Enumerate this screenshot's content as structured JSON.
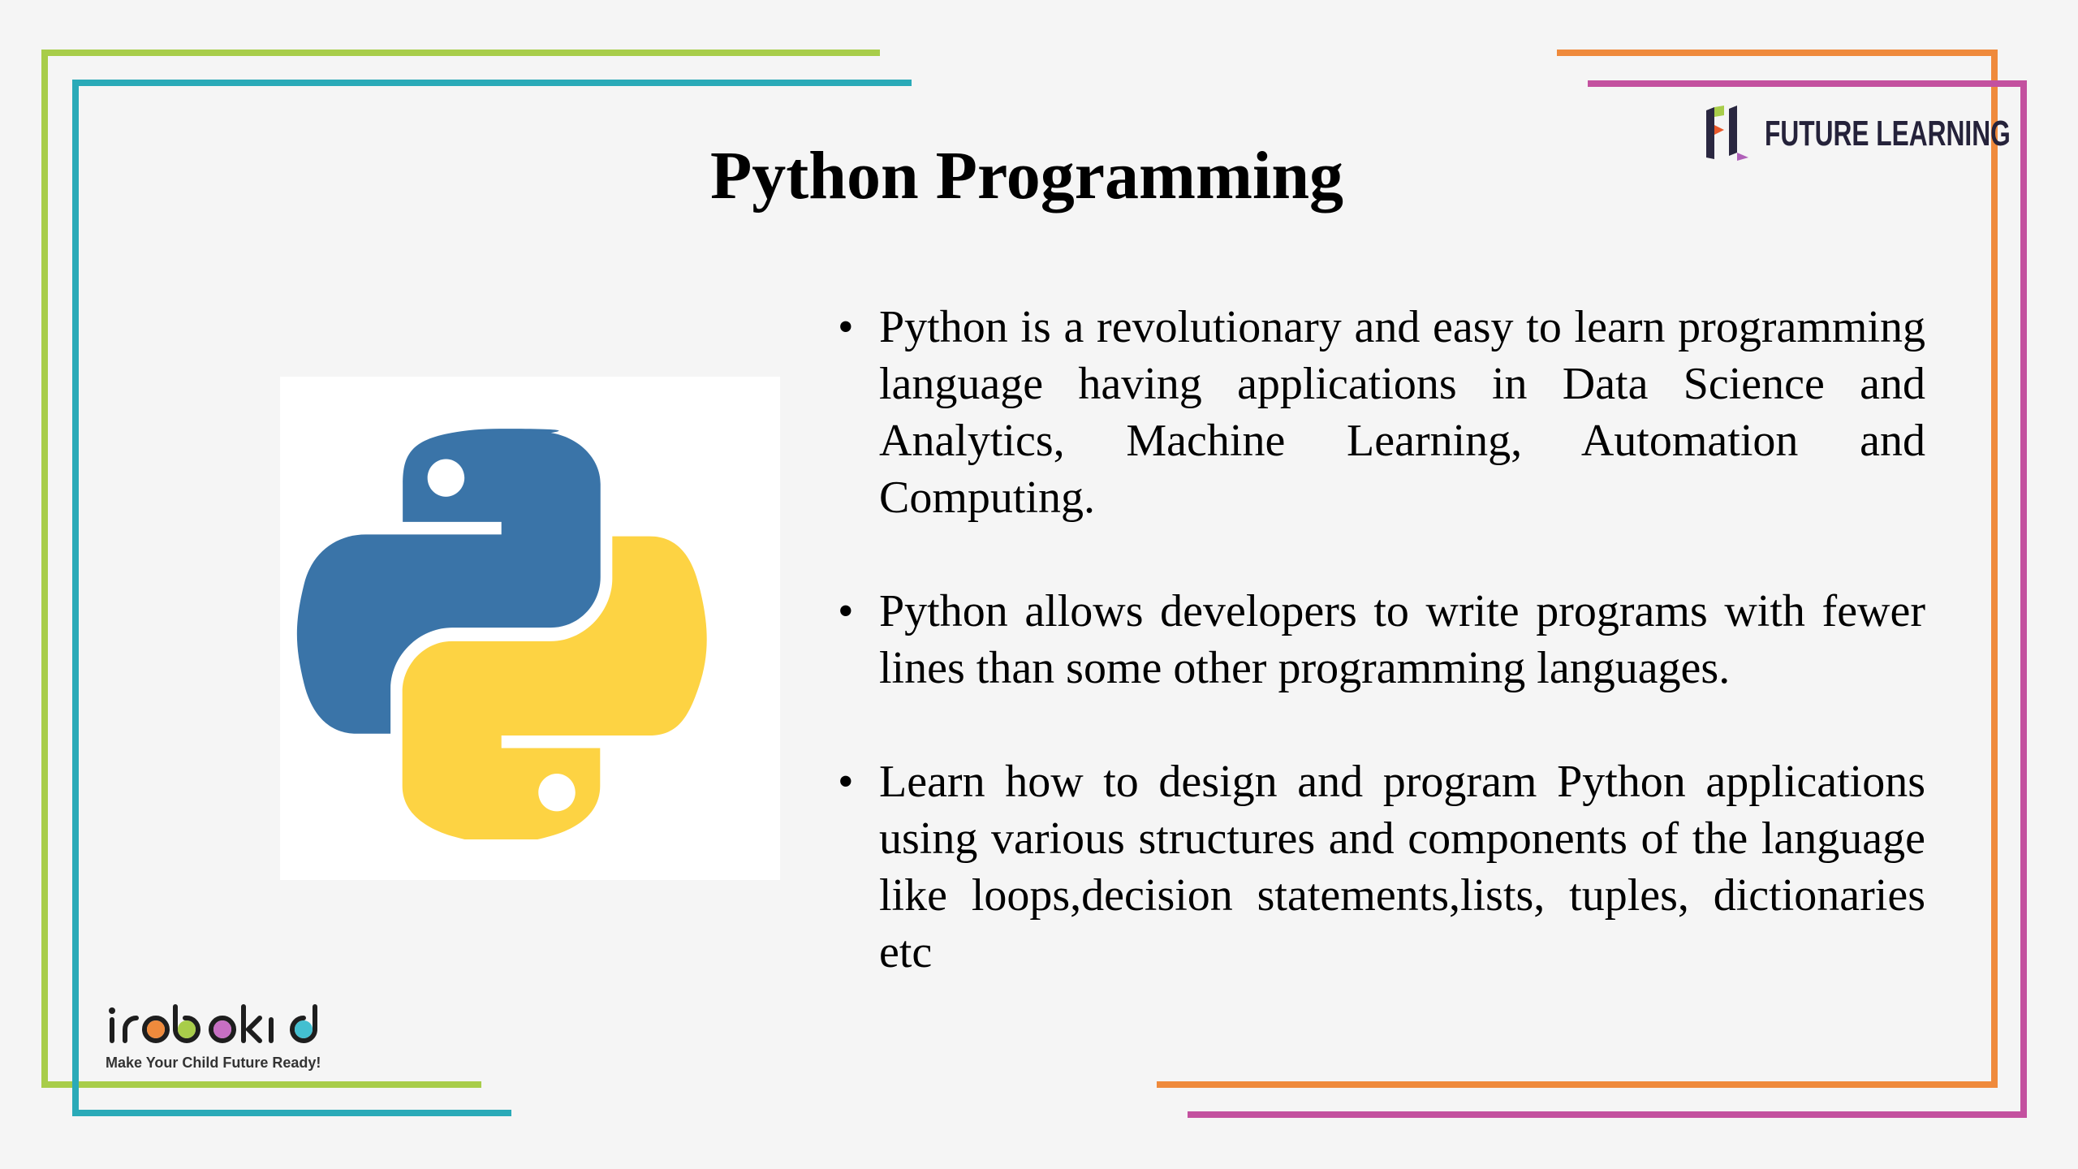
{
  "slide": {
    "title": "Python Programming",
    "bullets": [
      "Python is a revolutionary and easy to learn programming language having applications in Data Science and Analytics, Machine Learning, Automation and Computing.",
      "Python allows developers to write programs with fewer lines than some other programming languages.",
      "Learn how to design and program Python applications using various structures and components of the language like loops,decision statements,lists, tuples, dictionaries etc"
    ],
    "bullet_symbol": "•"
  },
  "logos": {
    "future_learning": "FUTURE LEARNING",
    "irobokid": "irobokid",
    "irobokid_tagline": "Make Your Child Future Ready!"
  },
  "colors": {
    "green": "#a8cd4a",
    "teal": "#2aaab8",
    "orange": "#ef8a3c",
    "magenta": "#c3519f",
    "python_blue": "#3a74a8",
    "python_yellow": "#fdd343"
  }
}
